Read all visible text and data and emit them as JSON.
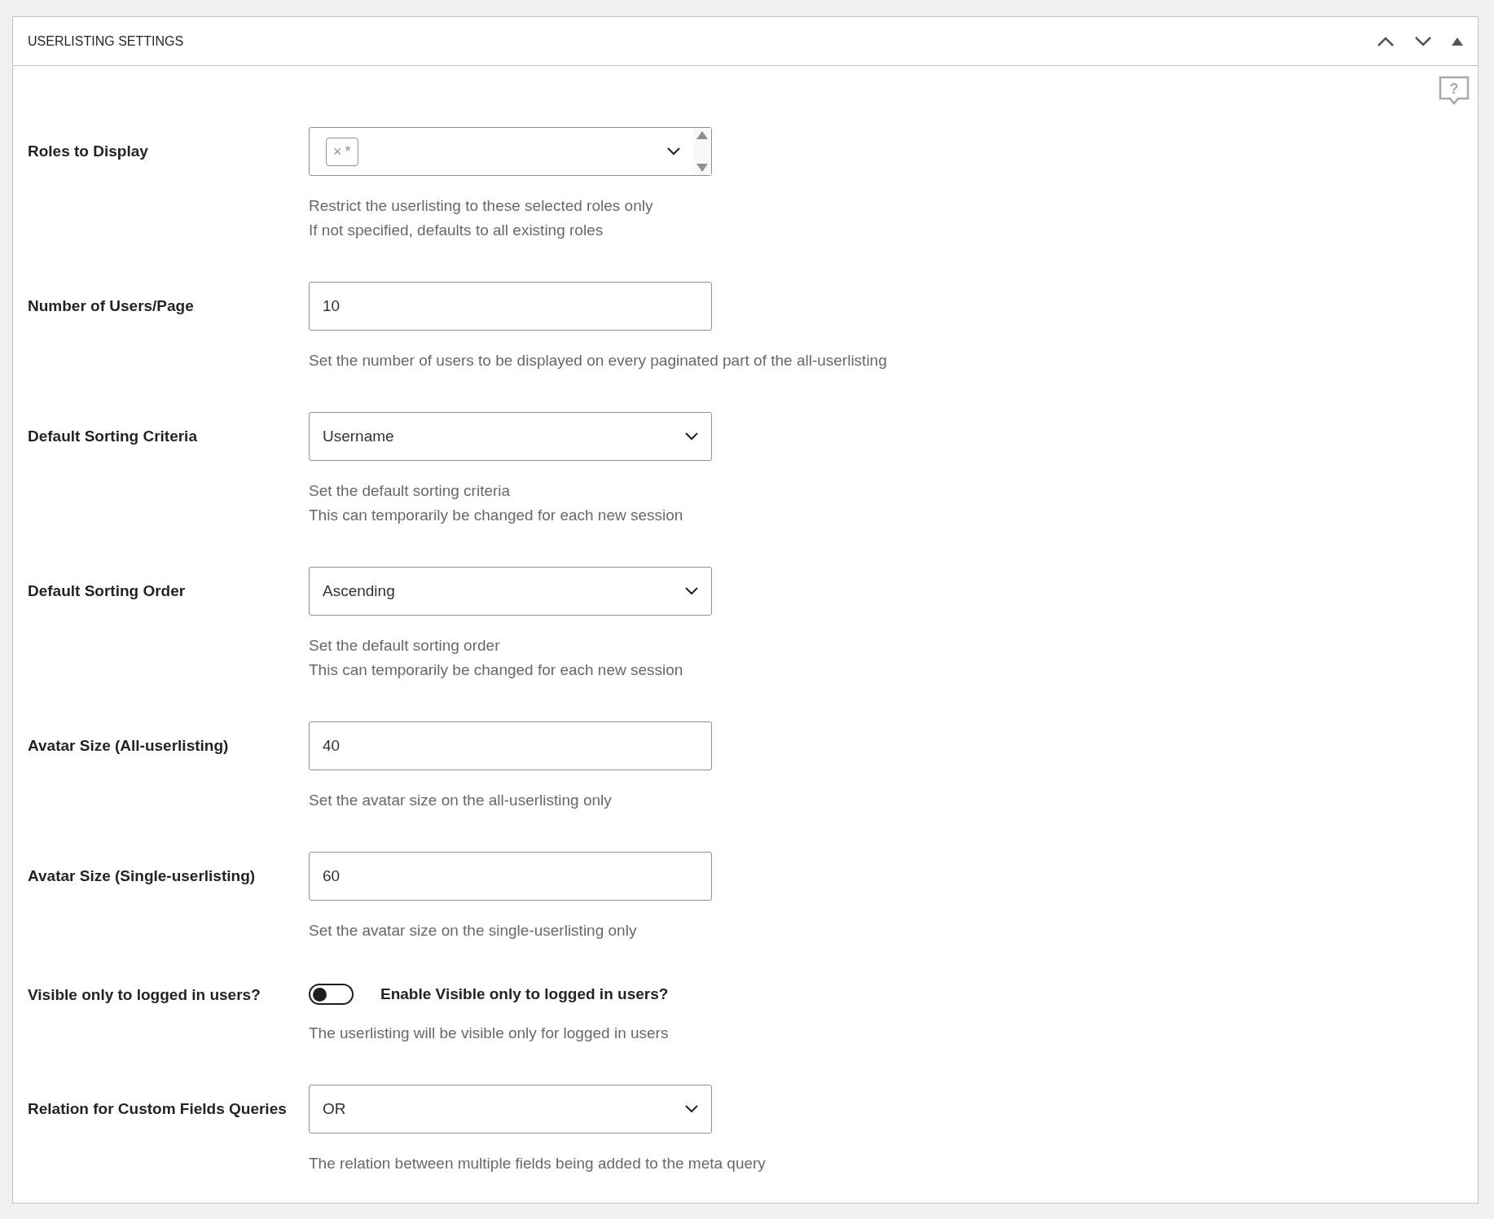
{
  "panel": {
    "title": "USERLISTING SETTINGS",
    "help_glyph": "?"
  },
  "fields": [
    {
      "kind": "multiselect",
      "label": "Roles to Display",
      "tags": [
        {
          "remove": "×",
          "label": "*"
        }
      ],
      "help": [
        "Restrict the userlisting to these selected roles only",
        "If not specified, defaults to all existing roles"
      ]
    },
    {
      "kind": "text",
      "label": "Number of Users/Page",
      "value": "10",
      "help": [
        "Set the number of users to be displayed on every paginated part of the all-userlisting"
      ]
    },
    {
      "kind": "select",
      "label": "Default Sorting Criteria",
      "value": "Username",
      "help": [
        "Set the default sorting criteria",
        "This can temporarily be changed for each new session"
      ]
    },
    {
      "kind": "select",
      "label": "Default Sorting Order",
      "value": "Ascending",
      "help": [
        "Set the default sorting order",
        "This can temporarily be changed for each new session"
      ]
    },
    {
      "kind": "text",
      "label": "Avatar Size (All-userlisting)",
      "value": "40",
      "help": [
        "Set the avatar size on the all-userlisting only"
      ]
    },
    {
      "kind": "text",
      "label": "Avatar Size (Single-userlisting)",
      "value": "60",
      "help": [
        "Set the avatar size on the single-userlisting only"
      ]
    },
    {
      "kind": "toggle",
      "label": "Visible only to logged in users?",
      "toggle_label": "Enable Visible only to logged in users?",
      "on": false,
      "help": [
        "The userlisting will be visible only for logged in users"
      ]
    },
    {
      "kind": "select",
      "label": "Relation for Custom Fields Queries",
      "value": "OR",
      "help": [
        "The relation between multiple fields being added to the meta query"
      ]
    }
  ]
}
